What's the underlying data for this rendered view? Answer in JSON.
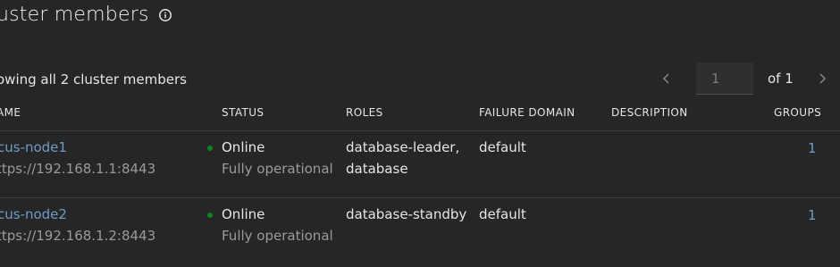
{
  "header": {
    "title": "uster members",
    "info_icon": "info-circle-icon"
  },
  "summary": "owing all 2 cluster members",
  "pagination": {
    "current_page": "1",
    "of_label": "of 1"
  },
  "columns": [
    "AME",
    "STATUS",
    "ROLES",
    "FAILURE DOMAIN",
    "DESCRIPTION",
    "GROUPS"
  ],
  "members": [
    {
      "name": "cus-node1",
      "url": "ttps://192.168.1.1:8443",
      "status": "Online",
      "status_detail": "Fully operational",
      "roles_line1": "database-leader,",
      "roles_line2": "database",
      "failure_domain": "default",
      "description": "",
      "groups": "1"
    },
    {
      "name": "cus-node2",
      "url": "ttps://192.168.1.2:8443",
      "status": "Online",
      "status_detail": "Fully operational",
      "roles_line1": "database-standby",
      "roles_line2": "",
      "failure_domain": "default",
      "description": "",
      "groups": "1"
    }
  ],
  "colors": {
    "background": "#262626",
    "link": "#6f9bc6",
    "online": "#0e8420"
  }
}
